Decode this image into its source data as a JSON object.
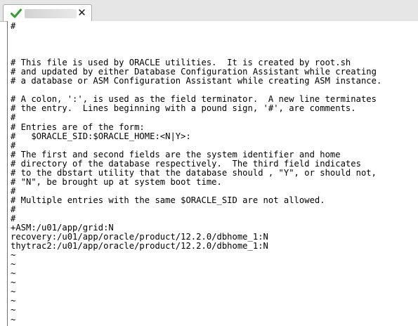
{
  "tab": {
    "status_icon": "checkmark-icon",
    "status_color": "#2ca02c",
    "name": "",
    "close_label": "✕"
  },
  "editor": {
    "lines": [
      "#",
      "",
      "",
      "",
      "# This file is used by ORACLE utilities.  It is created by root.sh",
      "# and updated by either Database Configuration Assistant while creating",
      "# a database or ASM Configuration Assistant while creating ASM instance.",
      "",
      "# A colon, ':', is used as the field terminator.  A new line terminates",
      "# the entry.  Lines beginning with a pound sign, '#', are comments.",
      "#",
      "# Entries are of the form:",
      "#   $ORACLE_SID:$ORACLE_HOME:<N|Y>:",
      "#",
      "# The first and second fields are the system identifier and home",
      "# directory of the database respectively.  The third field indicates",
      "# to the dbstart utility that the database should , \"Y\", or should not,",
      "# \"N\", be brought up at system boot time.",
      "#",
      "# Multiple entries with the same $ORACLE_SID are not allowed.",
      "#",
      "#",
      "+ASM:/u01/app/grid:N",
      "recovery:/u01/app/oracle/product/12.2.0/dbhome_1:N",
      "thytrac2:/u01/app/oracle/product/12.2.0/dbhome_1:N"
    ],
    "tilde_lines": [
      "~",
      "~",
      "~",
      "~",
      "~",
      "~",
      "~",
      "~",
      "~"
    ]
  }
}
